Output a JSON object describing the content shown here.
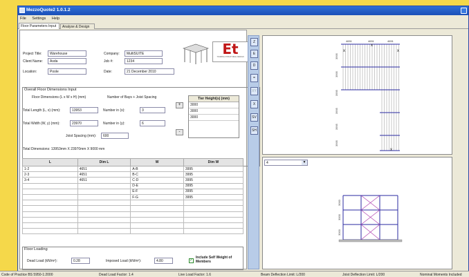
{
  "window": {
    "title": "MezzoQuote2 1.0.1.2"
  },
  "menu": [
    "File",
    "Settings",
    "Help"
  ],
  "tabs": [
    "Floor Parameters Input",
    "Analyse & Design"
  ],
  "project": {
    "title_label": "Project Title:",
    "title": "Warehouse",
    "client_label": "Client Name:",
    "client": "Asda",
    "location_label": "Location:",
    "location": "Poole",
    "company_label": "Company:",
    "company": "MultiSUITE",
    "job_label": "Job #:",
    "job": "1234",
    "date_label": "Date:",
    "date": "21 December 2010"
  },
  "logo": {
    "text": "Et",
    "tagline": "TOURING STRUCTURAL DESIGN"
  },
  "dims": {
    "group_title": "Overall Floor Dimensions Input",
    "floor_dims_label": "Floor Dimensions (L x W x H) (mm)",
    "bays_label": "Number of Bays + Joist Spacing",
    "length_label": "Total Length (L, x) (mm):",
    "length": "13953",
    "width_label": "Total Width (W, y) (mm):",
    "width": "23970",
    "nx_label": "Number in (x):",
    "nx": "3",
    "ny_label": "Number in (y):",
    "ny": "6",
    "joist_label": "Joist Spacing (mm):",
    "joist": "600",
    "plus": "+",
    "minus": "-"
  },
  "tier": {
    "header": "Tier Height(s) (mm)",
    "rows": [
      "3000",
      "3000",
      "3000"
    ]
  },
  "total_dims": "Total Dimensions: 13953mm X 23970mm X 9000 mm",
  "table": {
    "headers": [
      "L",
      "Dim L",
      "W",
      "Dim W"
    ],
    "rows": [
      [
        "1-2",
        "4651",
        "A-B",
        "3995"
      ],
      [
        "2-3",
        "4651",
        "B-C",
        "3995"
      ],
      [
        "3-4",
        "4651",
        "C-D",
        "3995"
      ],
      [
        "",
        "",
        "D-E",
        "3995"
      ],
      [
        "",
        "",
        "E-F",
        "3995"
      ],
      [
        "",
        "",
        "F-G",
        "3995"
      ],
      [
        "",
        "",
        "",
        ""
      ],
      [
        "",
        "",
        "",
        ""
      ],
      [
        "",
        "",
        "",
        ""
      ],
      [
        "",
        "",
        "",
        ""
      ],
      [
        "",
        "",
        "",
        ""
      ],
      [
        "",
        "",
        "",
        ""
      ]
    ]
  },
  "loading": {
    "group_title": "Floor Loading",
    "dead_label": "Dead Load (kN/m²):",
    "dead": "0.28",
    "imposed_label": "Imposed Load (kN/m²):",
    "imposed": "4.80",
    "self_weight_label": "Include Self Weight of Members",
    "self_weight_checked": true
  },
  "toolbar": [
    "Z",
    "E",
    "D",
    "=",
    "XY",
    "X",
    "SV",
    "SH"
  ],
  "plan_view": {
    "dim_top": [
      "4651",
      "4651",
      "4651"
    ],
    "dim_side": [
      "3995",
      "3995",
      "3995",
      "3995",
      "3995",
      "3995"
    ]
  },
  "elevation": {
    "combo_value": "4",
    "tier_labels": [
      "3000",
      "3000",
      "3000"
    ]
  },
  "status": {
    "code": "Code of Practice BS 5950-1:2000",
    "dead_factor": "Dead Load Factor: 1.4",
    "live_factor": "Live Load Factor: 1.6",
    "beam_limit": "Beam Deflection Limit: L/200",
    "joist_limit": "Joist Deflection Limit: L/200",
    "moments": "Nominal Moments Included"
  },
  "colors": {
    "accent": "#2f6fd6",
    "member": "#2a2aa0",
    "bracing": "#b040b0"
  }
}
